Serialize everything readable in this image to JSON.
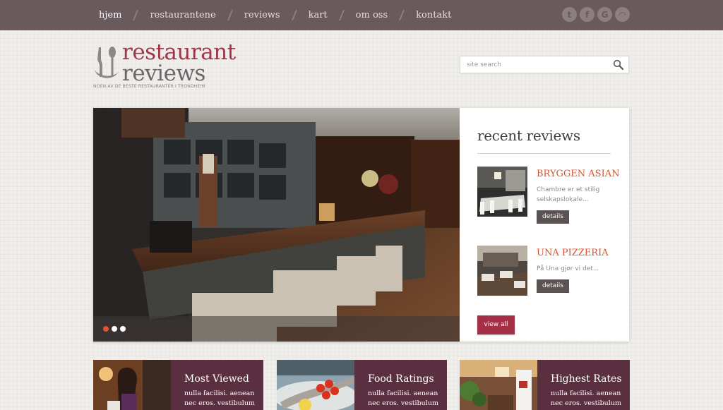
{
  "nav": {
    "items": [
      {
        "label": "hjem"
      },
      {
        "label": "restaurantene"
      },
      {
        "label": "reviews"
      },
      {
        "label": "kart"
      },
      {
        "label": "om oss"
      },
      {
        "label": "kontakt"
      }
    ],
    "active_index": 0
  },
  "social": [
    {
      "icon": "twitter-icon",
      "glyph": "t"
    },
    {
      "icon": "facebook-icon",
      "glyph": "f"
    },
    {
      "icon": "google-icon",
      "glyph": "G"
    },
    {
      "icon": "rss-icon",
      "glyph": "◠"
    }
  ],
  "logo": {
    "line1": "restaurant",
    "line2": "reviews",
    "tagline": "NOEN AV DE BESTE RESTAURANTER I TRONDHEIM"
  },
  "search": {
    "placeholder": "site search"
  },
  "slider": {
    "dot_count": 3,
    "active_dot": 0
  },
  "recent_reviews": {
    "title": "recent reviews",
    "items": [
      {
        "name": "BRYGGEN ASIAN",
        "excerpt": "Chambre er et stilig selskapslokale...",
        "button": "details"
      },
      {
        "name": "UNA PIZZERIA",
        "excerpt": "På Una gjør vi det...",
        "button": "details"
      }
    ],
    "view_all": "view all"
  },
  "features": [
    {
      "title": "Most Viewed",
      "text": "nulla facilisi. aenean nec eros. vestibulum"
    },
    {
      "title": "Food Ratings",
      "text": "nulla facilisi. aenean nec eros. vestibulum"
    },
    {
      "title": "Highest Rates",
      "text": "nulla facilisi. aenean nec eros. vestibulum"
    }
  ],
  "colors": {
    "topbar": "#6a5a5d",
    "brand": "#a2354a",
    "accent": "#d3552d",
    "feature_bg": "#5a3040"
  }
}
